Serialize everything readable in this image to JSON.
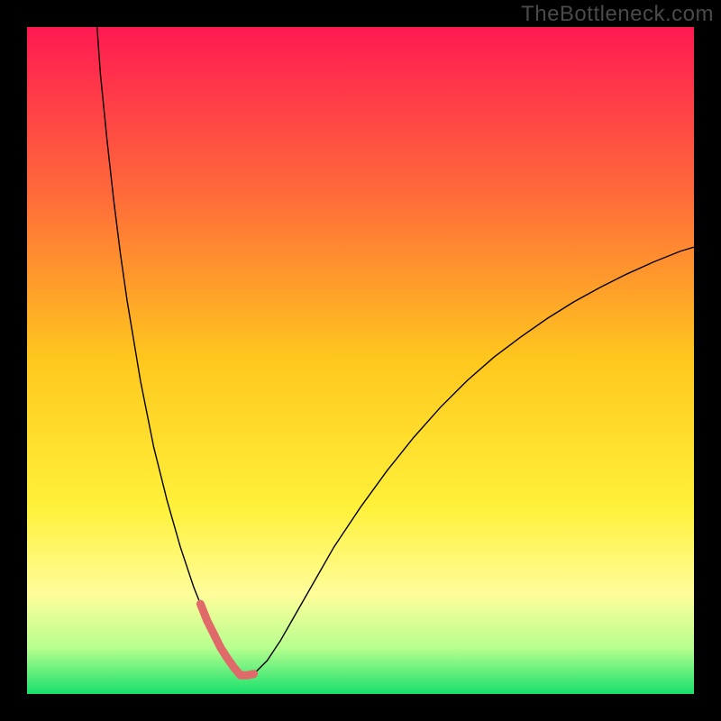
{
  "watermark": "TheBottleneck.com",
  "chart_data": {
    "type": "line",
    "title": "",
    "xlabel": "",
    "ylabel": "",
    "xlim": [
      0,
      100
    ],
    "ylim": [
      0,
      100
    ],
    "background_gradient": {
      "stops": [
        {
          "offset": 0.0,
          "color": "#ff1a52"
        },
        {
          "offset": 0.25,
          "color": "#ff6a3a"
        },
        {
          "offset": 0.5,
          "color": "#ffc81e"
        },
        {
          "offset": 0.72,
          "color": "#fff13a"
        },
        {
          "offset": 0.85,
          "color": "#fffd9a"
        },
        {
          "offset": 0.93,
          "color": "#b8ff8f"
        },
        {
          "offset": 1.0,
          "color": "#18e06c"
        }
      ]
    },
    "series": [
      {
        "name": "bottleneck-curve",
        "type": "line",
        "color": "#000000",
        "width": 1.4,
        "x": [
          10.5,
          11,
          12,
          13,
          14,
          15,
          16,
          17,
          18,
          19,
          20,
          21,
          22,
          23,
          24,
          25,
          26,
          27,
          28,
          29,
          30,
          31,
          32,
          34,
          36,
          38,
          40,
          42,
          44,
          46,
          48,
          50,
          54,
          58,
          62,
          66,
          70,
          74,
          78,
          82,
          86,
          90,
          94,
          98,
          100
        ],
        "y": [
          100,
          93,
          83,
          74,
          66,
          59,
          53,
          47,
          42,
          37,
          33,
          29,
          25.5,
          22,
          19,
          16,
          13.5,
          11,
          9,
          7,
          5.4,
          4,
          2.8,
          3,
          5,
          8,
          11.5,
          15,
          18.5,
          22,
          25,
          28,
          33.5,
          38.5,
          43,
          47,
          50.5,
          53.5,
          56.3,
          58.8,
          61,
          63,
          64.8,
          66.4,
          67
        ]
      },
      {
        "name": "bottleneck-minimum-marker",
        "type": "line",
        "color": "#e06a6a",
        "width": 9,
        "linecap": "round",
        "x": [
          26,
          27,
          28,
          29,
          30,
          31,
          32,
          33,
          34
        ],
        "y": [
          13.5,
          11,
          9,
          7,
          5.4,
          4,
          2.8,
          2.8,
          3
        ]
      }
    ]
  }
}
